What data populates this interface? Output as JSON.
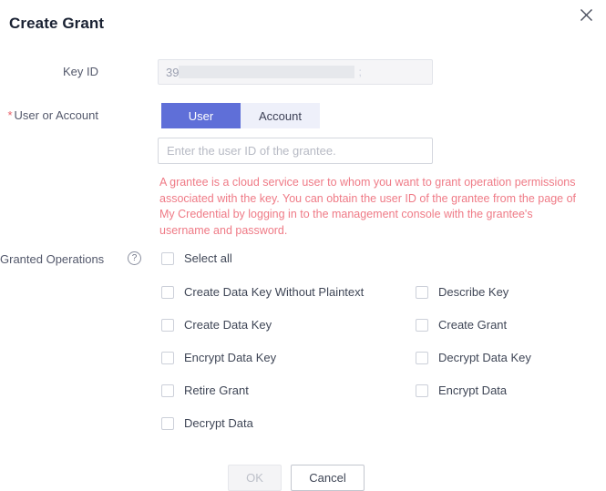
{
  "dialog": {
    "title": "Create Grant",
    "close_icon": "close-icon"
  },
  "fields": {
    "key_id": {
      "label": "Key ID",
      "value_prefix": "39",
      "value_suffix": ";",
      "redacted": true
    },
    "user_or_account": {
      "label": "User or Account",
      "required_marker": "*",
      "options": [
        "User",
        "Account"
      ],
      "selected": "User",
      "input_placeholder": "Enter the user ID of the grantee.",
      "input_value": ""
    },
    "warning": "A grantee is a cloud service user to whom you want to grant operation permissions associated with the key. You can obtain the user ID of the grantee from the page of My Credential by logging in to the management console with the grantee's username and password.",
    "granted_operations": {
      "label": "Granted Operations",
      "help_icon": "?",
      "select_all": {
        "label": "Select all",
        "checked": false
      },
      "left_column": [
        {
          "label": "Create Data Key Without Plaintext",
          "checked": false
        },
        {
          "label": "Create Data Key",
          "checked": false
        },
        {
          "label": "Encrypt Data Key",
          "checked": false
        },
        {
          "label": "Retire Grant",
          "checked": false
        },
        {
          "label": "Decrypt Data",
          "checked": false
        }
      ],
      "right_column": [
        {
          "label": "Describe Key",
          "checked": false
        },
        {
          "label": "Create Grant",
          "checked": false
        },
        {
          "label": "Decrypt Data Key",
          "checked": false
        },
        {
          "label": "Encrypt Data",
          "checked": false
        }
      ]
    }
  },
  "footer": {
    "ok_label": "OK",
    "ok_disabled": true,
    "cancel_label": "Cancel"
  },
  "colors": {
    "accent": "#5f6fd8",
    "accent_light": "#eef0fa",
    "required": "#e8616a",
    "warning_text": "#ef7a86",
    "title": "#1a2233",
    "label": "#53586b",
    "checkbox_border": "#ccd0d9"
  }
}
